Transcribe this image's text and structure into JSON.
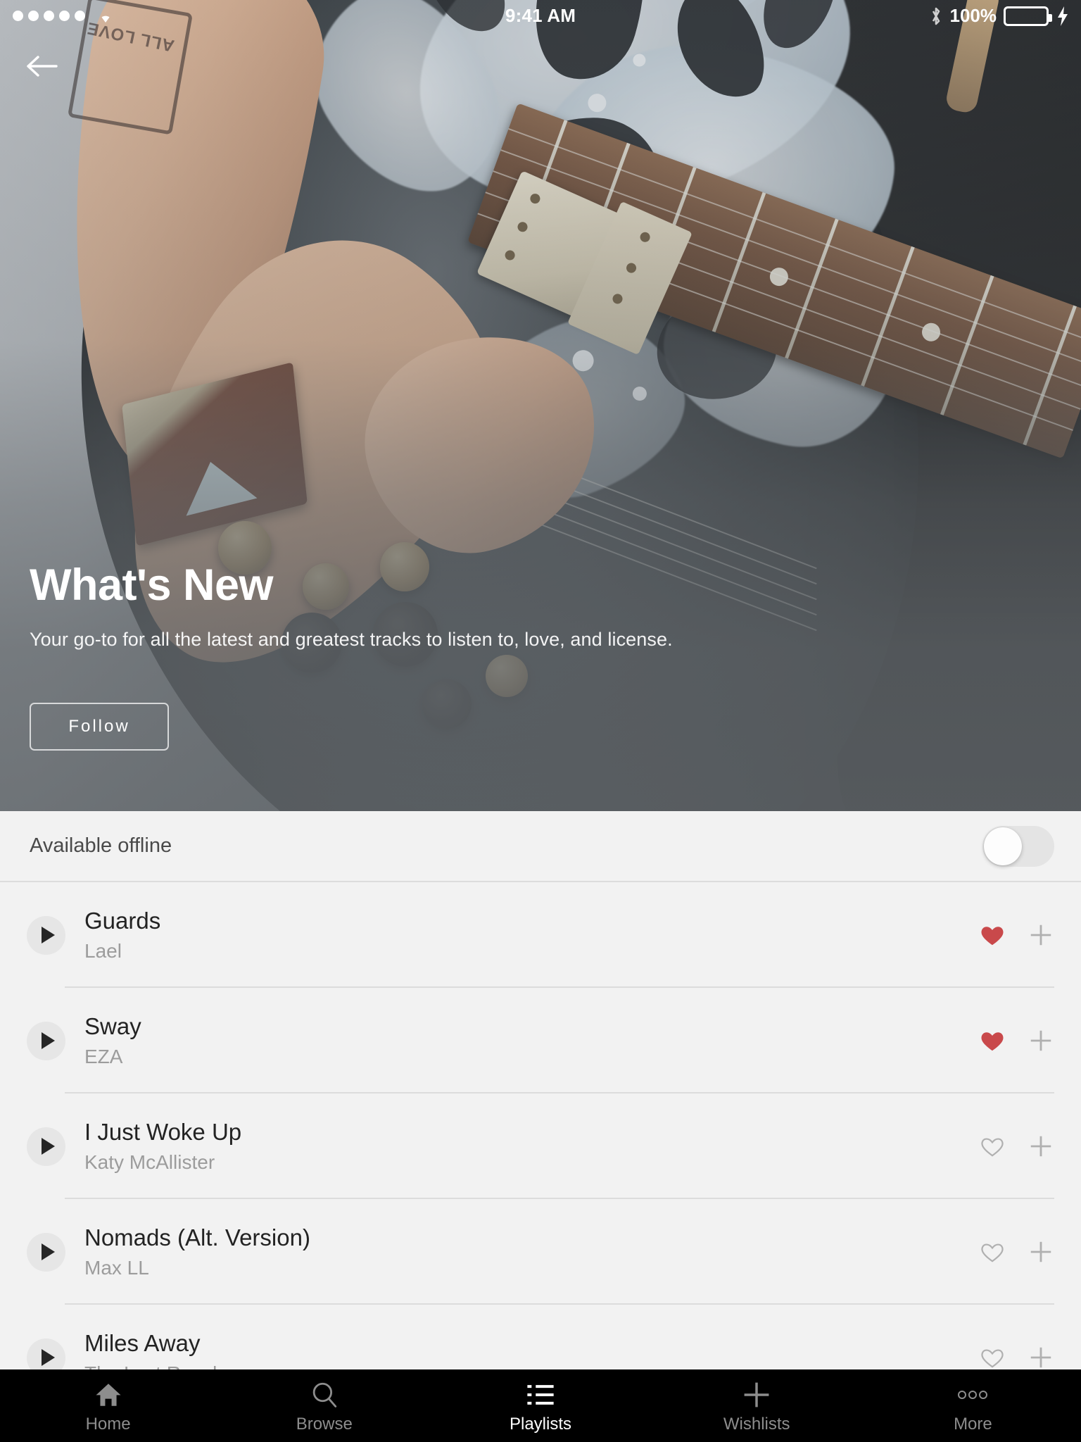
{
  "statusbar": {
    "signal_dots": 5,
    "wifi_icon": "wifi-icon",
    "time": "9:41 AM",
    "bluetooth_icon": "bluetooth-icon",
    "battery_percent": "100%",
    "battery_color": "#4cd863",
    "charging_icon": "lightning-bolt-icon"
  },
  "hero": {
    "back_icon": "back-arrow-icon",
    "title": "What's New",
    "subtitle": "Your go-to for all the latest and greatest tracks to listen to, love, and license.",
    "follow_label": "Follow",
    "tattoo_text": "ALL LOVE"
  },
  "offline": {
    "label": "Available offline",
    "toggle_state": "off"
  },
  "tracks": [
    {
      "title": "Guards",
      "artist": "Lael",
      "liked": true,
      "heart_icon": "heart-filled-icon",
      "add_icon": "plus-icon",
      "play_icon": "play-icon"
    },
    {
      "title": "Sway",
      "artist": "EZA",
      "liked": true,
      "heart_icon": "heart-filled-icon",
      "add_icon": "plus-icon",
      "play_icon": "play-icon"
    },
    {
      "title": "I Just Woke Up",
      "artist": "Katy McAllister",
      "liked": false,
      "heart_icon": "heart-outline-icon",
      "add_icon": "plus-icon",
      "play_icon": "play-icon"
    },
    {
      "title": "Nomads (Alt. Version)",
      "artist": "Max LL",
      "liked": false,
      "heart_icon": "heart-outline-icon",
      "add_icon": "plus-icon",
      "play_icon": "play-icon"
    },
    {
      "title": "Miles Away",
      "artist": "The Last Royals",
      "liked": false,
      "heart_icon": "heart-outline-icon",
      "add_icon": "plus-icon",
      "play_icon": "play-icon"
    }
  ],
  "colors": {
    "heart_liked": "#c9494b",
    "heart_idle": "#b0b0b0",
    "plus": "#b0b0b0",
    "list_bg": "#f2f2f2",
    "tabbar_bg": "#000000",
    "tab_active": "#ffffff",
    "tab_inactive": "#8d8d8d"
  },
  "tabbar": {
    "items": [
      {
        "label": "Home",
        "icon": "home-icon",
        "active": false
      },
      {
        "label": "Browse",
        "icon": "search-icon",
        "active": false
      },
      {
        "label": "Playlists",
        "icon": "list-icon",
        "active": true
      },
      {
        "label": "Wishlists",
        "icon": "plus-icon",
        "active": false
      },
      {
        "label": "More",
        "icon": "ellipsis-icon",
        "active": false
      }
    ]
  }
}
